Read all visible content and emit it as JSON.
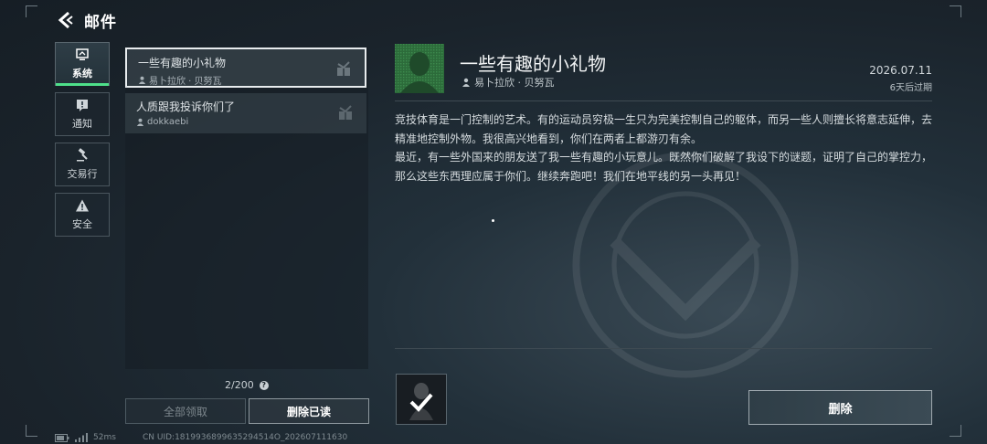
{
  "header": {
    "title": "邮件"
  },
  "categories": [
    {
      "label": "系统",
      "icon": "monitor-icon",
      "active": true
    },
    {
      "label": "通知",
      "icon": "notice-icon",
      "active": false
    },
    {
      "label": "交易行",
      "icon": "gavel-icon",
      "active": false
    },
    {
      "label": "安全",
      "icon": "warning-icon",
      "active": false
    }
  ],
  "mail_list": [
    {
      "subject": "一些有趣的小礼物",
      "sender": "易卜拉欣 · 贝努瓦",
      "selected": true
    },
    {
      "subject": "人质跟我投诉你们了",
      "sender": "dokkaebi",
      "selected": false
    }
  ],
  "list_footer": {
    "count": "2/200",
    "help": "?"
  },
  "buttons": {
    "claim_all": "全部领取",
    "delete_read": "删除已读",
    "delete": "删除"
  },
  "status": {
    "ping": "52ms",
    "uid": "CN UID:1819936899635294514O_202607111630"
  },
  "detail": {
    "title": "一些有趣的小礼物",
    "sender": "易卜拉欣 · 贝努瓦",
    "date": "2026.07.11",
    "expire": "6天后过期",
    "body": [
      "竞技体育是一门控制的艺术。有的运动员穷极一生只为完美控制自己的躯体，而另一些人则擅长将意志延伸，去精准地控制外物。我很高兴地看到，你们在两者上都游刃有余。",
      "最近，有一些外国来的朋友送了我一些有趣的小玩意儿。既然你们破解了我设下的谜题，证明了自己的掌控力，那么这些东西理应属于你们。继续奔跑吧！我们在地平线的另一头再见！"
    ]
  },
  "colors": {
    "active_tab_accent": "#4ee08a",
    "avatar_bg": "#2c6b3a"
  }
}
